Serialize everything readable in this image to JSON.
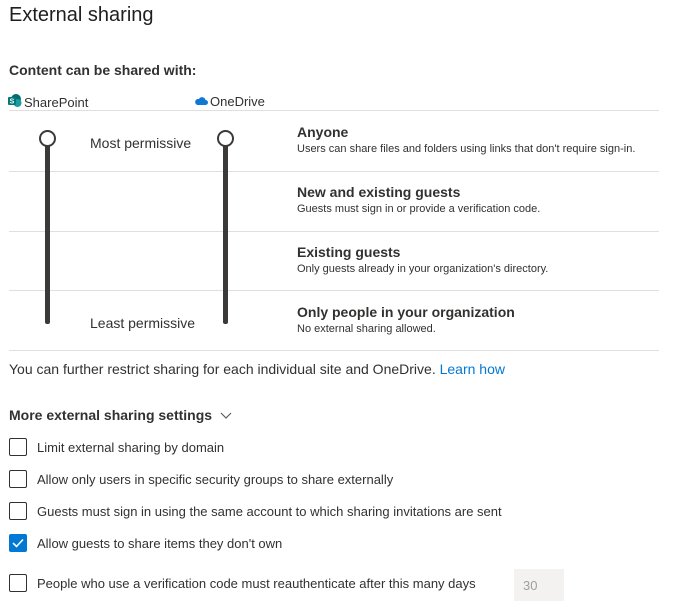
{
  "page": {
    "title": "External sharing"
  },
  "sharing": {
    "heading": "Content can be shared with:",
    "apps": {
      "sharepoint": "SharePoint",
      "onedrive": "OneDrive"
    },
    "sharepoint_level": "Anyone",
    "onedrive_level": "Anyone",
    "most_permissive": "Most permissive",
    "least_permissive": "Least permissive",
    "levels": [
      {
        "title": "Anyone",
        "desc": "Users can share files and folders using links that don't require sign-in."
      },
      {
        "title": "New and existing guests",
        "desc": "Guests must sign in or provide a verification code."
      },
      {
        "title": "Existing guests",
        "desc": "Only guests already in your organization's directory."
      },
      {
        "title": "Only people in your organization",
        "desc": "No external sharing allowed."
      }
    ]
  },
  "note": {
    "text": "You can further restrict sharing for each individual site and OneDrive.",
    "link": "Learn how"
  },
  "more": {
    "heading": "More external sharing settings",
    "options": [
      {
        "label": "Limit external sharing by domain",
        "checked": false
      },
      {
        "label": "Allow only users in specific security groups to share externally",
        "checked": false
      },
      {
        "label": "Guests must sign in using the same account to which sharing invitations are sent",
        "checked": false
      },
      {
        "label": "Allow guests to share items they don't own",
        "checked": true
      },
      {
        "label": "People who use a verification code must reauthenticate after this many days",
        "checked": false
      }
    ],
    "days_value": "30"
  },
  "colors": {
    "accent": "#0078d4",
    "track": "#3b3a39",
    "divider": "#e1dfdd",
    "sharepoint": "#036c70",
    "onedrive": "#0f78d4"
  },
  "icons": {
    "sharepoint": "sharepoint-icon",
    "onedrive": "onedrive-cloud-icon",
    "chevron": "chevron-down-icon",
    "check": "checkmark-icon"
  }
}
